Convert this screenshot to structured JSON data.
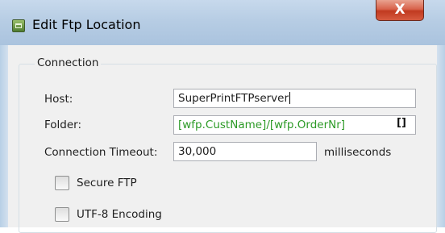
{
  "window": {
    "title": "Edit Ftp Location",
    "close_label": "X"
  },
  "connection": {
    "group_label": "Connection",
    "host_label": "Host:",
    "host_value": "SuperPrintFTPserver",
    "folder_label": "Folder:",
    "folder_value": "[wfp.CustName]/[wfp.OrderNr]",
    "folder_button_label": "[]",
    "timeout_label": "Connection Timeout:",
    "timeout_value": "30,000",
    "timeout_unit": "milliseconds",
    "secure_ftp_label": "Secure FTP",
    "secure_ftp_checked": false,
    "utf8_label": "UTF-8 Encoding",
    "utf8_checked": false
  },
  "colors": {
    "folder_text": "#2c9a26",
    "title_bar": "#b7cde4",
    "close_button": "#c13a20",
    "dialog_background": "#f0f0f0"
  }
}
